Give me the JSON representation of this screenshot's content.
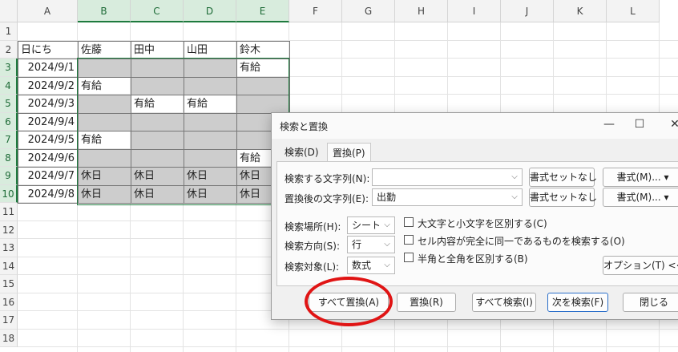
{
  "columns": [
    "A",
    "B",
    "C",
    "D",
    "E",
    "F",
    "G",
    "H",
    "I",
    "J",
    "K",
    "L"
  ],
  "rows": [
    "1",
    "2",
    "3",
    "4",
    "5",
    "6",
    "7",
    "8",
    "9",
    "10",
    "11",
    "12",
    "13",
    "14",
    "15",
    "16",
    "17",
    "18"
  ],
  "headers": [
    "日にち",
    "佐藤",
    "田中",
    "山田",
    "鈴木"
  ],
  "data": [
    [
      "2024/9/1",
      "",
      "",
      "",
      "有給"
    ],
    [
      "2024/9/2",
      "有給",
      "",
      "",
      ""
    ],
    [
      "2024/9/3",
      "",
      "有給",
      "有給",
      ""
    ],
    [
      "2024/9/4",
      "",
      "",
      "",
      ""
    ],
    [
      "2024/9/5",
      "有給",
      "",
      "",
      ""
    ],
    [
      "2024/9/6",
      "",
      "",
      "",
      "有給"
    ],
    [
      "2024/9/7",
      "休日",
      "休日",
      "休日",
      "休日"
    ],
    [
      "2024/9/8",
      "休日",
      "休日",
      "休日",
      "休日"
    ]
  ],
  "dialog": {
    "title": "検索と置換",
    "minimize": "—",
    "maximize": "☐",
    "close": "✕",
    "tabs": [
      "検索(D)",
      "置換(P)"
    ],
    "find_label": "検索する文字列(N):",
    "find_value": "",
    "replace_label": "置換後の文字列(E):",
    "replace_value": "出勤",
    "format_none": "書式セットなし",
    "format_btn": "書式(M)...",
    "within_label": "検索場所(H):",
    "within_value": "シート",
    "search_label": "検索方向(S):",
    "search_value": "行",
    "lookin_label": "検索対象(L):",
    "lookin_value": "数式",
    "opt_case": "大文字と小文字を区別する(C)",
    "opt_entire": "セル内容が完全に同一であるものを検索する(O)",
    "opt_width": "半角と全角を区別する(B)",
    "options_btn": "オプション(T) <<",
    "replace_all": "すべて置換(A)",
    "replace": "置換(R)",
    "find_all": "すべて検索(I)",
    "find_next": "次を検索(F)",
    "close_btn": "閉じる"
  }
}
